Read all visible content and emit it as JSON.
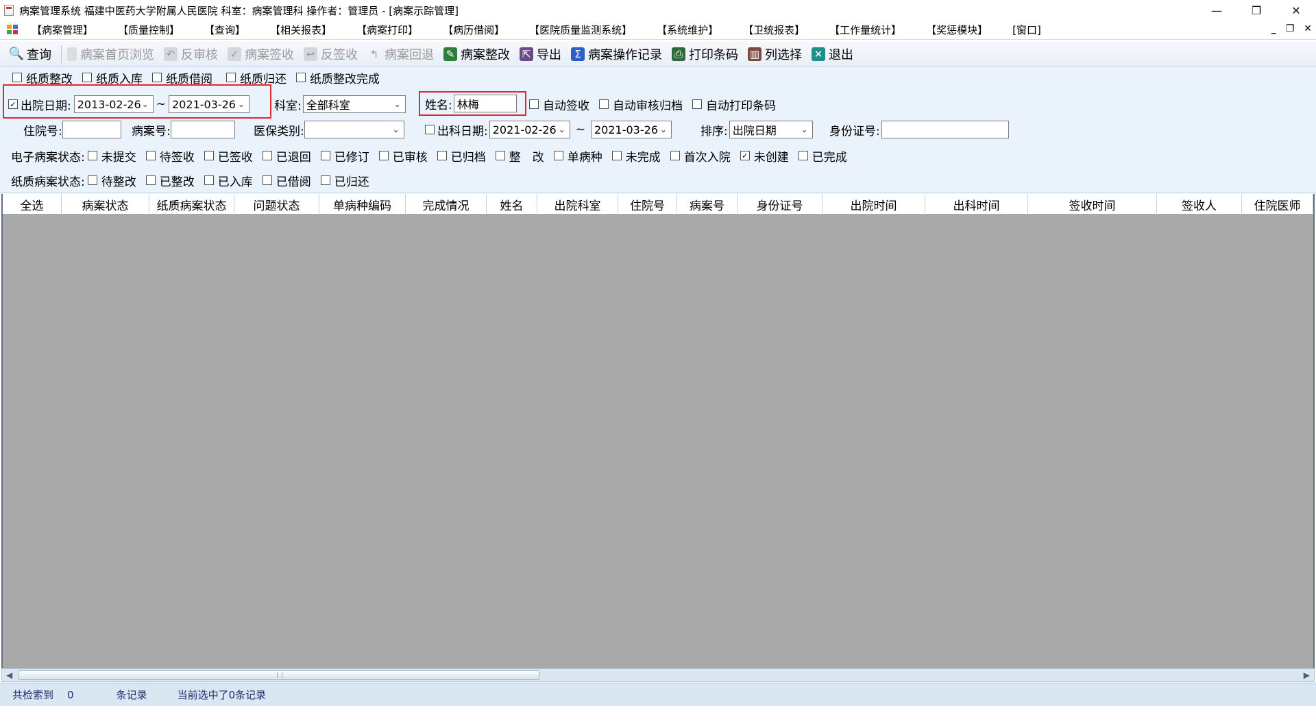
{
  "window": {
    "title": "病案管理系统  福建中医药大学附属人民医院  科室：病案管理科 操作者：管理员 - [病案示踪管理]",
    "minimize": "—",
    "restore": "❐",
    "close": "✕"
  },
  "menu": {
    "items": [
      "【病案管理】",
      "【质量控制】",
      "【查询】",
      "【相关报表】",
      "【病案打印】",
      "【病历借阅】",
      "【医院质量监测系统】",
      "【系统维护】",
      "【卫统报表】",
      "【工作量统计】",
      "【奖惩模块】",
      "[窗口]"
    ],
    "mdi_min": "_",
    "mdi_restore": "❐",
    "mdi_close": "✕"
  },
  "toolbar": {
    "query": "查询",
    "homepage_browse": "病案首页浏览",
    "unaudit": "反审核",
    "sign_in": "病案签收",
    "unsign": "反签收",
    "return_back": "病案回退",
    "rectify": "病案整改",
    "export": "导出",
    "op_log": "病案操作记录",
    "print_barcode": "打印条码",
    "column_select": "列选择",
    "exit": "退出"
  },
  "filters": {
    "row1": [
      "纸质整改",
      "纸质入库",
      "纸质借阅",
      "纸质归还",
      "纸质整改完成"
    ],
    "discharge_date_label": "出院日期:",
    "discharge_date_checked": true,
    "discharge_date_from": "2013-02-26",
    "discharge_date_to": "2021-03-26",
    "tilde": "~",
    "dept_label": "科室:",
    "dept_value": "全部科室",
    "name_label": "姓名:",
    "name_value": "林梅",
    "auto_sign": "自动签收",
    "auto_audit_archive": "自动审核归档",
    "auto_print_barcode": "自动打印条码",
    "inpatient_no_label": "住院号:",
    "inpatient_no_value": "",
    "record_no_label": "病案号:",
    "record_no_value": "",
    "insurance_label": "医保类别:",
    "insurance_value": "",
    "dept_out_date_label": "出科日期:",
    "dept_out_from": "2021-02-26",
    "dept_out_to": "2021-03-26",
    "sort_label": "排序:",
    "sort_value": "出院日期",
    "id_card_label": "身份证号:",
    "id_card_value": "",
    "emr_status_label": "电子病案状态:",
    "emr_status": [
      "未提交",
      "待签收",
      "已签收",
      "已退回",
      "已修订",
      "已审核",
      "已归档",
      "整　改",
      "单病种",
      "未完成",
      "首次入院",
      "未创建",
      "已完成"
    ],
    "emr_status_checked_index": 11,
    "paper_status_label": "纸质病案状态:",
    "paper_status": [
      "待整改",
      "已整改",
      "已入库",
      "已借阅",
      "已归还"
    ]
  },
  "grid": {
    "columns": [
      "全选",
      "病案状态",
      "纸质病案状态",
      "问题状态",
      "单病种编码",
      "完成情况",
      "姓名",
      "出院科室",
      "住院号",
      "病案号",
      "身份证号",
      "出院时间",
      "出科时间",
      "签收时间",
      "签收人",
      "住院医师"
    ]
  },
  "status": {
    "found_prefix": "共检索到",
    "count": "0",
    "record_unit": "条记录",
    "selected": "当前选中了0条记录"
  },
  "colors": {
    "highlight_border": "#e0282e",
    "grid_bg": "#a9a9a9",
    "panel_bg": "#eaf2fb"
  }
}
